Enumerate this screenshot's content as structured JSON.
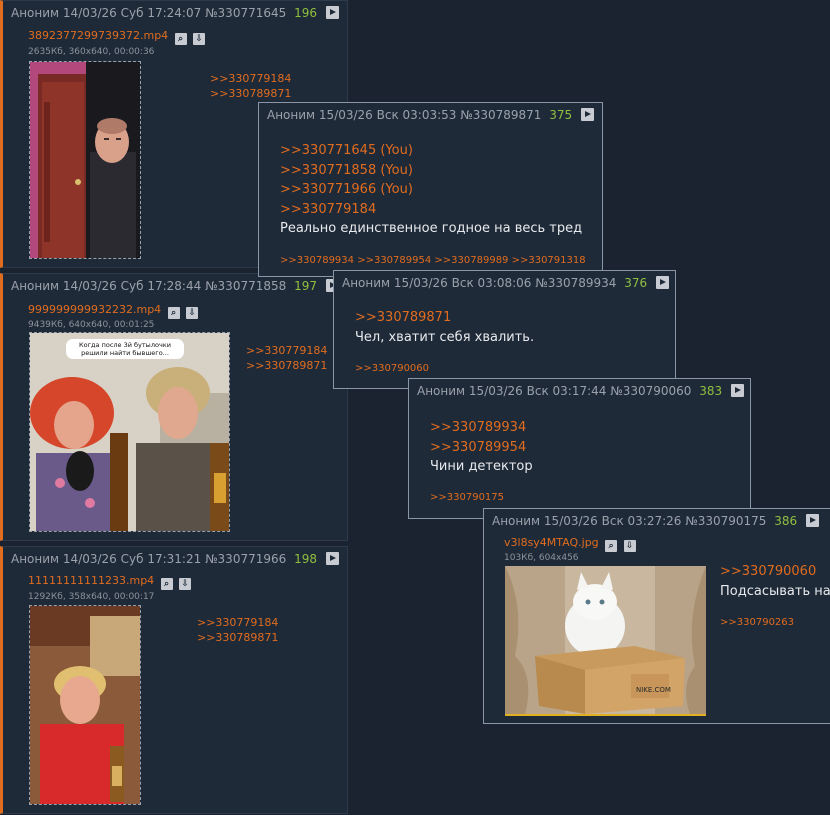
{
  "posts": [
    {
      "author": "Аноним",
      "date": "14/03/26 Суб 17:24:07",
      "num": "№330771645",
      "count": "196",
      "file": "3892377299739372.mp4",
      "meta": "2635Кб, 360x640, 00:00:36",
      "replies": [
        ">>330779184",
        ">>330789871"
      ]
    },
    {
      "author": "Аноним",
      "date": "14/03/26 Суб 17:28:44",
      "num": "№330771858",
      "count": "197",
      "file": "999999999932232.mp4",
      "meta": "9439Кб, 640x640, 00:01:25",
      "thumb_caption": "Когда после 3й бутылочки решили найти бывшего...",
      "replies": [
        ">>330779184",
        ">>330789871"
      ]
    },
    {
      "author": "Аноним",
      "date": "14/03/26 Суб 17:31:21",
      "num": "№330771966",
      "count": "198",
      "file": "11111111111233.mp4",
      "meta": "1292Кб, 358x640, 00:00:17",
      "replies": [
        ">>330779184",
        ">>330789871"
      ]
    }
  ],
  "popups": [
    {
      "author": "Аноним",
      "date": "15/03/26 Вск 03:03:53",
      "num": "№330789871",
      "count": "375",
      "quotes": [
        ">>330771645 (You)",
        ">>330771858 (You)",
        ">>330771966 (You)",
        ">>330779184"
      ],
      "text": "Реально единственное годное на весь тред",
      "replies": ">>330789934 >>330789954 >>330789989 >>330791318"
    },
    {
      "author": "Аноним",
      "date": "15/03/26 Вск 03:08:06",
      "num": "№330789934",
      "count": "376",
      "quotes": [
        ">>330789871"
      ],
      "text": "Чел, хватит себя хвалить.",
      "replies": ">>330790060"
    },
    {
      "author": "Аноним",
      "date": "15/03/26 Вск 03:17:44",
      "num": "№330790060",
      "count": "383",
      "quotes": [
        ">>330789934",
        ">>330789954"
      ],
      "text": "Чини детектор",
      "replies": ">>330790175"
    },
    {
      "author": "Аноним",
      "date": "15/03/26 Вск 03:27:26",
      "num": "№330790175",
      "count": "386",
      "file": "v3l8sy4MTAQ.jpg",
      "meta": "103Кб, 604x456",
      "box_text": "NIKE.COM",
      "quotes": [
        ">>330790060"
      ],
      "text": "Подсасывать на",
      "replies": ">>330790263"
    }
  ]
}
